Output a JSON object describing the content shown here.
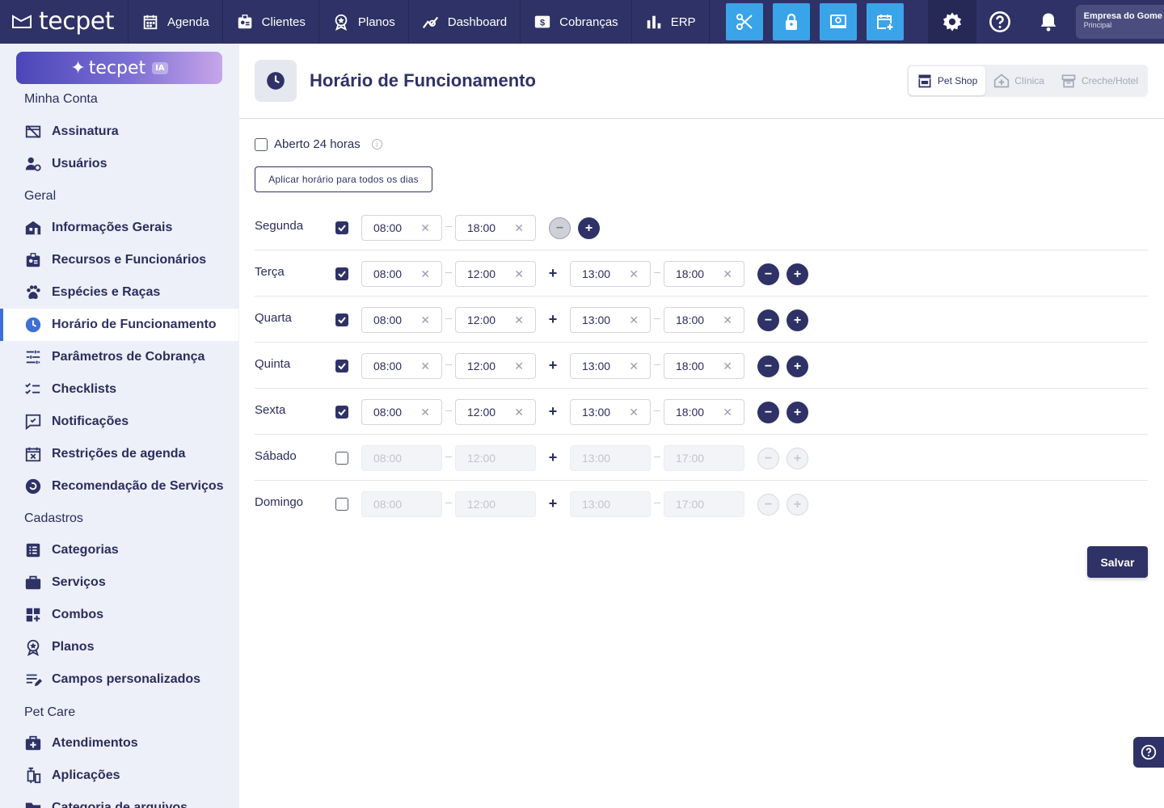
{
  "topbar": {
    "logo": "tecpet",
    "nav": [
      {
        "label": "Agenda",
        "icon": "calendar-icon"
      },
      {
        "label": "Clientes",
        "icon": "id-badge-icon"
      },
      {
        "label": "Planos",
        "icon": "medal-icon"
      },
      {
        "label": "Dashboard",
        "icon": "chart-line-icon"
      },
      {
        "label": "Cobranças",
        "icon": "dollar-card-icon"
      },
      {
        "label": "ERP",
        "icon": "bar-chart-icon"
      }
    ],
    "quick_actions": [
      "scissors-icon",
      "lock-icon",
      "monitor-icon",
      "calendar-plus-icon"
    ],
    "company_name": "Empresa do Gome",
    "company_sub": "Principal"
  },
  "sidebar": {
    "ia_label": "tecpet",
    "ia_badge": "IA",
    "sections": {
      "account": "Minha Conta",
      "general": "Geral",
      "registers": "Cadastros",
      "petcare": "Pet Care"
    },
    "items": {
      "assinatura": "Assinatura",
      "usuarios": "Usuários",
      "info": "Informações Gerais",
      "recursos": "Recursos e Funcionários",
      "especies": "Espécies e Raças",
      "horario": "Horário de Funcionamento",
      "parametros": "Parâmetros de Cobrança",
      "checklists": "Checklists",
      "notificacoes": "Notificações",
      "restricoes": "Restrições de agenda",
      "recomendacao": "Recomendação de Serviços",
      "categorias": "Categorias",
      "servicos": "Serviços",
      "combos": "Combos",
      "planos": "Planos",
      "campos": "Campos personalizados",
      "atendimentos": "Atendimentos",
      "aplicacoes": "Aplicações",
      "arquivos": "Categoria de arquivos"
    }
  },
  "page": {
    "title": "Horário de Funcionamento",
    "segments": [
      "Pet Shop",
      "Clínica",
      "Creche/Hotel"
    ],
    "open24_label": "Aberto 24 horas",
    "apply_all_label": "Aplicar horário para todos os dias",
    "save_label": "Salvar"
  },
  "schedule": {
    "segunda": {
      "day": "Segunda",
      "open": true,
      "p1_start": "08:00",
      "p1_end": "18:00"
    },
    "terca": {
      "day": "Terça",
      "open": true,
      "p1_start": "08:00",
      "p1_end": "12:00",
      "p2_start": "13:00",
      "p2_end": "18:00"
    },
    "quarta": {
      "day": "Quarta",
      "open": true,
      "p1_start": "08:00",
      "p1_end": "12:00",
      "p2_start": "13:00",
      "p2_end": "18:00"
    },
    "quinta": {
      "day": "Quinta",
      "open": true,
      "p1_start": "08:00",
      "p1_end": "12:00",
      "p2_start": "13:00",
      "p2_end": "18:00"
    },
    "sexta": {
      "day": "Sexta",
      "open": true,
      "p1_start": "08:00",
      "p1_end": "12:00",
      "p2_start": "13:00",
      "p2_end": "18:00"
    },
    "sabado": {
      "day": "Sábado",
      "open": false,
      "p1_start": "08:00",
      "p1_end": "12:00",
      "p2_start": "13:00",
      "p2_end": "17:00"
    },
    "domingo": {
      "day": "Domingo",
      "open": false,
      "p1_start": "08:00",
      "p1_end": "12:00",
      "p2_start": "13:00",
      "p2_end": "17:00"
    }
  },
  "glyphs": {
    "clear": "✕",
    "plus": "+",
    "minus": "−",
    "info": "i"
  },
  "colors": {
    "primary": "#2f3266",
    "accent": "#3aa4e9",
    "active_link": "#3d6fd6"
  }
}
